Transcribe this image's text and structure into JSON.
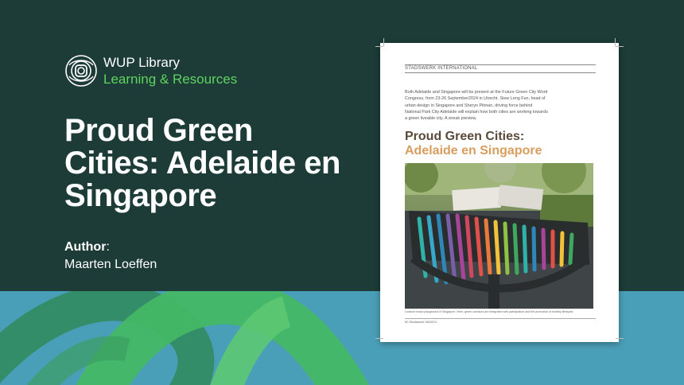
{
  "brand": {
    "name": "WUP Library",
    "tagline": "Learning & Resources"
  },
  "title": "Proud Green Cities: Adelaide en Singapore",
  "author": {
    "label": "Author",
    "name": "Maarten Loeffen"
  },
  "document": {
    "header": "STADSWERK INTERNATIONAL",
    "intro": "Both Adelaide and Singapore will be present at the Future Green City Word Congress, from 23-26 September2024 in Utrecht. Siew Leng Fun, head of urban design in Singapore and Sheryn Pitman, driving force behind National Park City Adelaide will explain how both cities are working towards a green liveable city. A sneak preview.",
    "heading_line1": "Proud Green Cities:",
    "heading_line2": "Adelaide en Singapore",
    "caption": "Outdoor music playground in Singapore. Here, green corridors are integrated with participation and the promotion of healthy lifestyles",
    "footer": "50   Stadswerk 06/2024"
  },
  "colors": {
    "background_dark": "#1d3c37",
    "accent_green": "#5fd35f",
    "bottom_blue": "#4a9fb8",
    "heading_brown": "#5a4a3a",
    "heading_orange": "#d99d5e"
  },
  "icons": {
    "logo": "wup-logo-icon"
  }
}
